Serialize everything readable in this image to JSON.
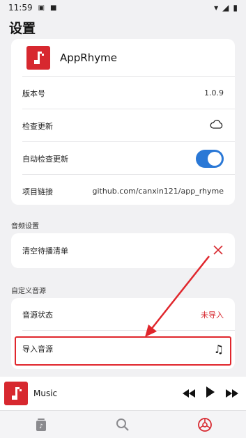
{
  "status_bar": {
    "time": "11:59"
  },
  "page_title": "设置",
  "app_info": {
    "name": "AppRhyme",
    "rows": [
      {
        "label": "版本号",
        "value": "1.0.9"
      },
      {
        "label": "检查更新"
      },
      {
        "label": "自动检查更新",
        "toggle": true
      },
      {
        "label": "项目链接",
        "value": "github.com/canxin121/app_rhyme"
      }
    ]
  },
  "audio_section": {
    "title": "音频设置",
    "rows": [
      {
        "label": "清空待播清单"
      }
    ]
  },
  "custom_source_section": {
    "title": "自定义音源",
    "rows": [
      {
        "label": "音源状态",
        "value": "未导入"
      },
      {
        "label": "导入音源"
      }
    ]
  },
  "player": {
    "title": "Music"
  },
  "colors": {
    "accent_red": "#d7282f",
    "toggle_blue": "#2a78d6",
    "annotation_red": "#e0262c"
  },
  "icons": [
    "music-note-icon",
    "cloud-icon",
    "close-x-icon",
    "rewind-icon",
    "play-icon",
    "fast-forward-icon",
    "library-icon",
    "search-icon",
    "settings-icon"
  ]
}
